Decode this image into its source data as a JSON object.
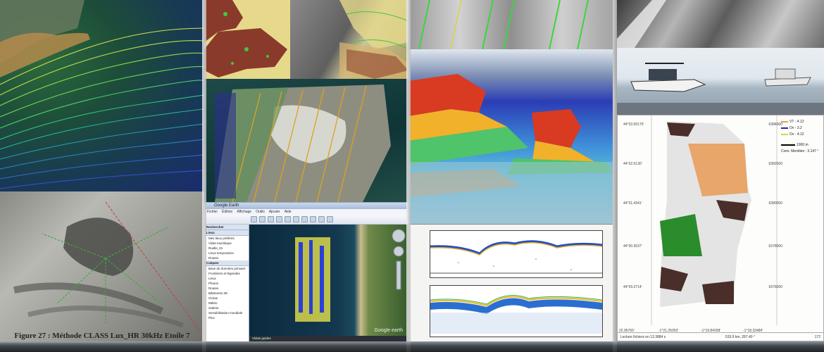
{
  "figure_caption": "Figure 27 : Méthode CLASS Lux_HR 30kHz Etoile 7",
  "google_earth": {
    "window_title": "Google Earth",
    "menu": [
      "Fichier",
      "Édition",
      "Affichage",
      "Outils",
      "Ajouter",
      "Aide"
    ],
    "sidebar_search_header": "Rechercher",
    "sidebar_places_header": "Lieux",
    "sidebar_items": [
      "Mes lieux préférés",
      "Visite touristique",
      "Ruelle_01",
      "Lieux temporaires",
      "Routes"
    ],
    "sidebar_layers_header": "Calques",
    "layer_items": [
      "Base de données primaire",
      "Frontières et légendes",
      "Lieux",
      "Photos",
      "Routes",
      "Bâtiments 3D",
      "Océan",
      "Météo",
      "Galerie",
      "Sensibilisation mondiale",
      "Plus"
    ],
    "status": "Vistas guides",
    "logo": "Google earth"
  },
  "echogram": {},
  "habitat_map": {
    "legend": [
      {
        "label": "VT - 4.12",
        "color": "#e8a24a"
      },
      {
        "label": "Ov - 3.2",
        "color": "#2a2aa0"
      },
      {
        "label": "Ov - 4.12",
        "color": "#d7d44a"
      }
    ],
    "scale_label": "1000 m",
    "grid_note": "Conv. Meridien : 3.147 °",
    "latitudes": [
      "44°33.59170'",
      "44°32.5130'",
      "44°31.4341'",
      "44°30.3537'",
      "44°29.2714'"
    ],
    "eastings": [
      "6384000",
      "6382000",
      "6380000",
      "6378000",
      "6376000"
    ],
    "longitudes": [
      "22.95765'",
      "-1°21.25053'",
      "-1°19.84268'",
      "-1°18.33484'"
    ],
    "footer_left": "Lecture fichiers en 13.3884 s",
    "footer_mid": "533.9 km, 287.40 °",
    "footer_right": "172"
  }
}
